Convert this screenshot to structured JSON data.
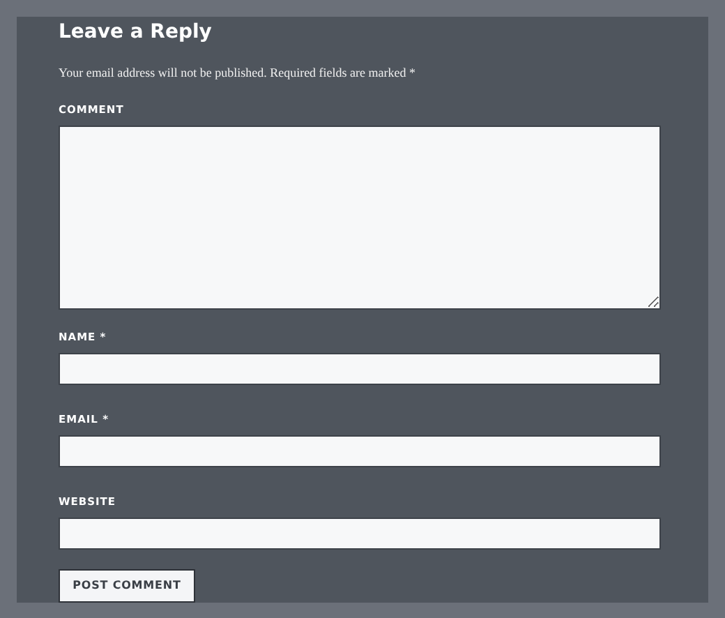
{
  "heading": "Leave a Reply",
  "notice": "Your email address will not be published. Required fields are marked *",
  "fields": [
    {
      "label": "COMMENT",
      "kind": "textarea"
    },
    {
      "label": "NAME *",
      "kind": "text"
    },
    {
      "label": "EMAIL *",
      "kind": "text"
    },
    {
      "label": "WEBSITE",
      "kind": "text"
    }
  ],
  "submit": "POST COMMENT"
}
